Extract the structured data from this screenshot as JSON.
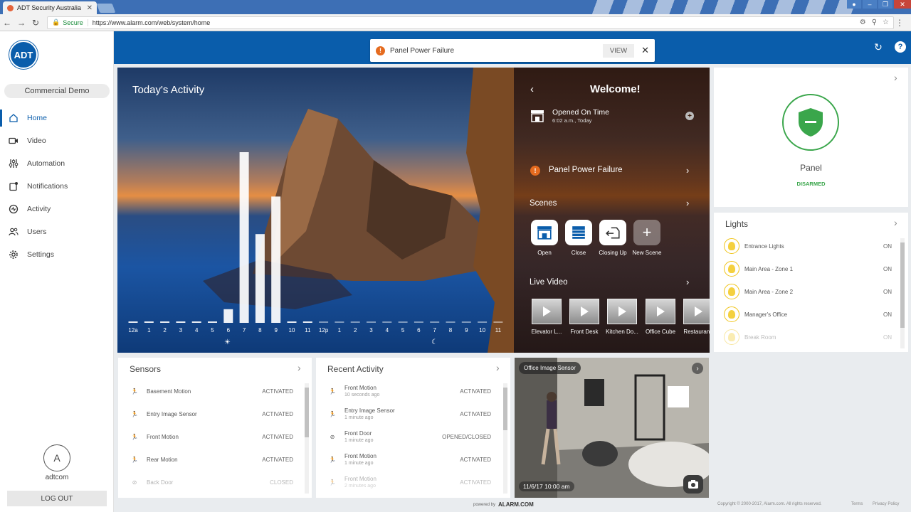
{
  "browser": {
    "tab_title": "ADT Security Australia",
    "secure_label": "Secure",
    "url": "https://www.alarm.com/web/system/home"
  },
  "sidebar": {
    "logo_text": "ADT",
    "account": "Commercial Demo",
    "items": [
      {
        "label": "Home",
        "icon": "home-icon"
      },
      {
        "label": "Video",
        "icon": "video-icon"
      },
      {
        "label": "Automation",
        "icon": "automation-icon"
      },
      {
        "label": "Notifications",
        "icon": "notifications-icon"
      },
      {
        "label": "Activity",
        "icon": "activity-icon"
      },
      {
        "label": "Users",
        "icon": "users-icon"
      },
      {
        "label": "Settings",
        "icon": "settings-icon"
      }
    ],
    "user_initial": "A",
    "username": "adtcom",
    "logout_label": "LOG OUT"
  },
  "header": {
    "alert_text": "Panel Power Failure",
    "view_label": "VIEW"
  },
  "activity": {
    "title": "Today's Activity",
    "hours": [
      "12a",
      "1",
      "2",
      "3",
      "4",
      "5",
      "6",
      "7",
      "8",
      "9",
      "10",
      "11",
      "12p",
      "1",
      "2",
      "3",
      "4",
      "5",
      "6",
      "7",
      "8",
      "9",
      "10",
      "11"
    ],
    "levels": [
      0,
      0,
      0,
      0,
      0,
      0,
      0.08,
      1.0,
      0.52,
      0.74,
      0,
      0,
      0,
      0,
      0,
      0,
      0,
      0,
      0,
      0,
      0,
      0,
      0,
      0
    ]
  },
  "welcome": {
    "title": "Welcome!",
    "opened_title": "Opened On Time",
    "opened_sub": "6:02 a.m., Today",
    "alert": "Panel Power Failure",
    "scenes_title": "Scenes",
    "scenes": [
      "Open",
      "Close",
      "Closing Up",
      "New Scene"
    ],
    "video_title": "Live Video",
    "videos": [
      "Elevator L...",
      "Front Desk",
      "Kitchen Do...",
      "Office Cube",
      "Restaurant"
    ]
  },
  "panel": {
    "title": "Panel",
    "status": "DISARMED"
  },
  "lights": {
    "title": "Lights",
    "items": [
      {
        "name": "Entrance Lights",
        "state": "ON"
      },
      {
        "name": "Main Area - Zone 1",
        "state": "ON"
      },
      {
        "name": "Main Area - Zone 2",
        "state": "ON"
      },
      {
        "name": "Manager's Office",
        "state": "ON"
      },
      {
        "name": "Break Room",
        "state": "ON"
      }
    ]
  },
  "sensors": {
    "title": "Sensors",
    "items": [
      {
        "name": "Basement Motion",
        "state": "ACTIVATED"
      },
      {
        "name": "Entry Image Sensor",
        "state": "ACTIVATED"
      },
      {
        "name": "Front Motion",
        "state": "ACTIVATED"
      },
      {
        "name": "Rear Motion",
        "state": "ACTIVATED"
      },
      {
        "name": "Back Door",
        "state": "CLOSED"
      }
    ]
  },
  "recent": {
    "title": "Recent Activity",
    "items": [
      {
        "name": "Front Motion",
        "time": "10 seconds ago",
        "state": "ACTIVATED"
      },
      {
        "name": "Entry Image Sensor",
        "time": "1 minute ago",
        "state": "ACTIVATED"
      },
      {
        "name": "Front Door",
        "time": "1 minute ago",
        "state": "OPENED/CLOSED"
      },
      {
        "name": "Front Motion",
        "time": "1 minute ago",
        "state": "ACTIVATED"
      },
      {
        "name": "Front Motion",
        "time": "2 minutes ago",
        "state": "ACTIVATED"
      }
    ]
  },
  "camera": {
    "label": "Office Image Sensor",
    "timestamp": "11/6/17 10:00 am"
  },
  "footer": {
    "powered_by": "powered by",
    "brand": "ALARM.COM",
    "copyright": "Copyright © 2000-2017, Alarm.com. All rights reserved.",
    "terms": "Terms",
    "privacy": "Privacy Policy"
  },
  "colors": {
    "brand_blue": "#0a5dab",
    "alert_orange": "#e56b1f",
    "disarmed_green": "#3aa64b"
  }
}
